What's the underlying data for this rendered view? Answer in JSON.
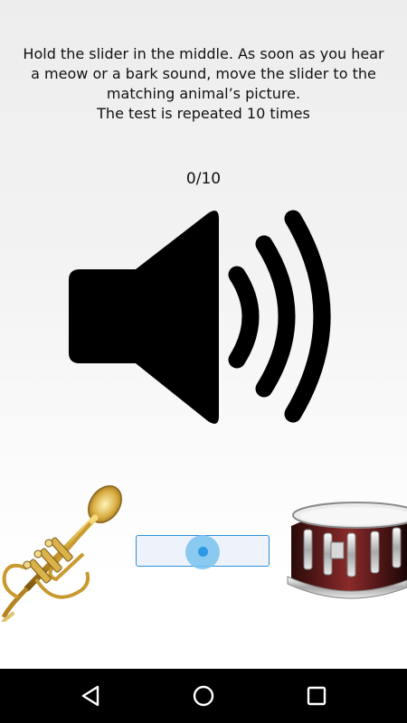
{
  "instructions": {
    "line1": "Hold the slider in the middle. As soon as you hear",
    "line2": "a meow or a bark sound, move the slider to the",
    "line3": "matching animal’s picture.",
    "line4": "The test is repeated 10 times"
  },
  "progress": {
    "current": 0,
    "total": 10,
    "label": "0/10"
  },
  "icons": {
    "sound": "speaker-volume-icon",
    "left_choice": "trumpet-image",
    "right_choice": "snare-drum-image",
    "nav_back": "back-triangle-icon",
    "nav_home": "home-circle-icon",
    "nav_recents": "recents-square-icon"
  },
  "slider": {
    "position": 0.5
  },
  "colors": {
    "slider_border": "#2e8fd8",
    "slider_fill": "#eef3fb",
    "thumb_outer": "#78c2ee",
    "thumb_inner": "#2b9ae3",
    "navbar": "#000000"
  }
}
